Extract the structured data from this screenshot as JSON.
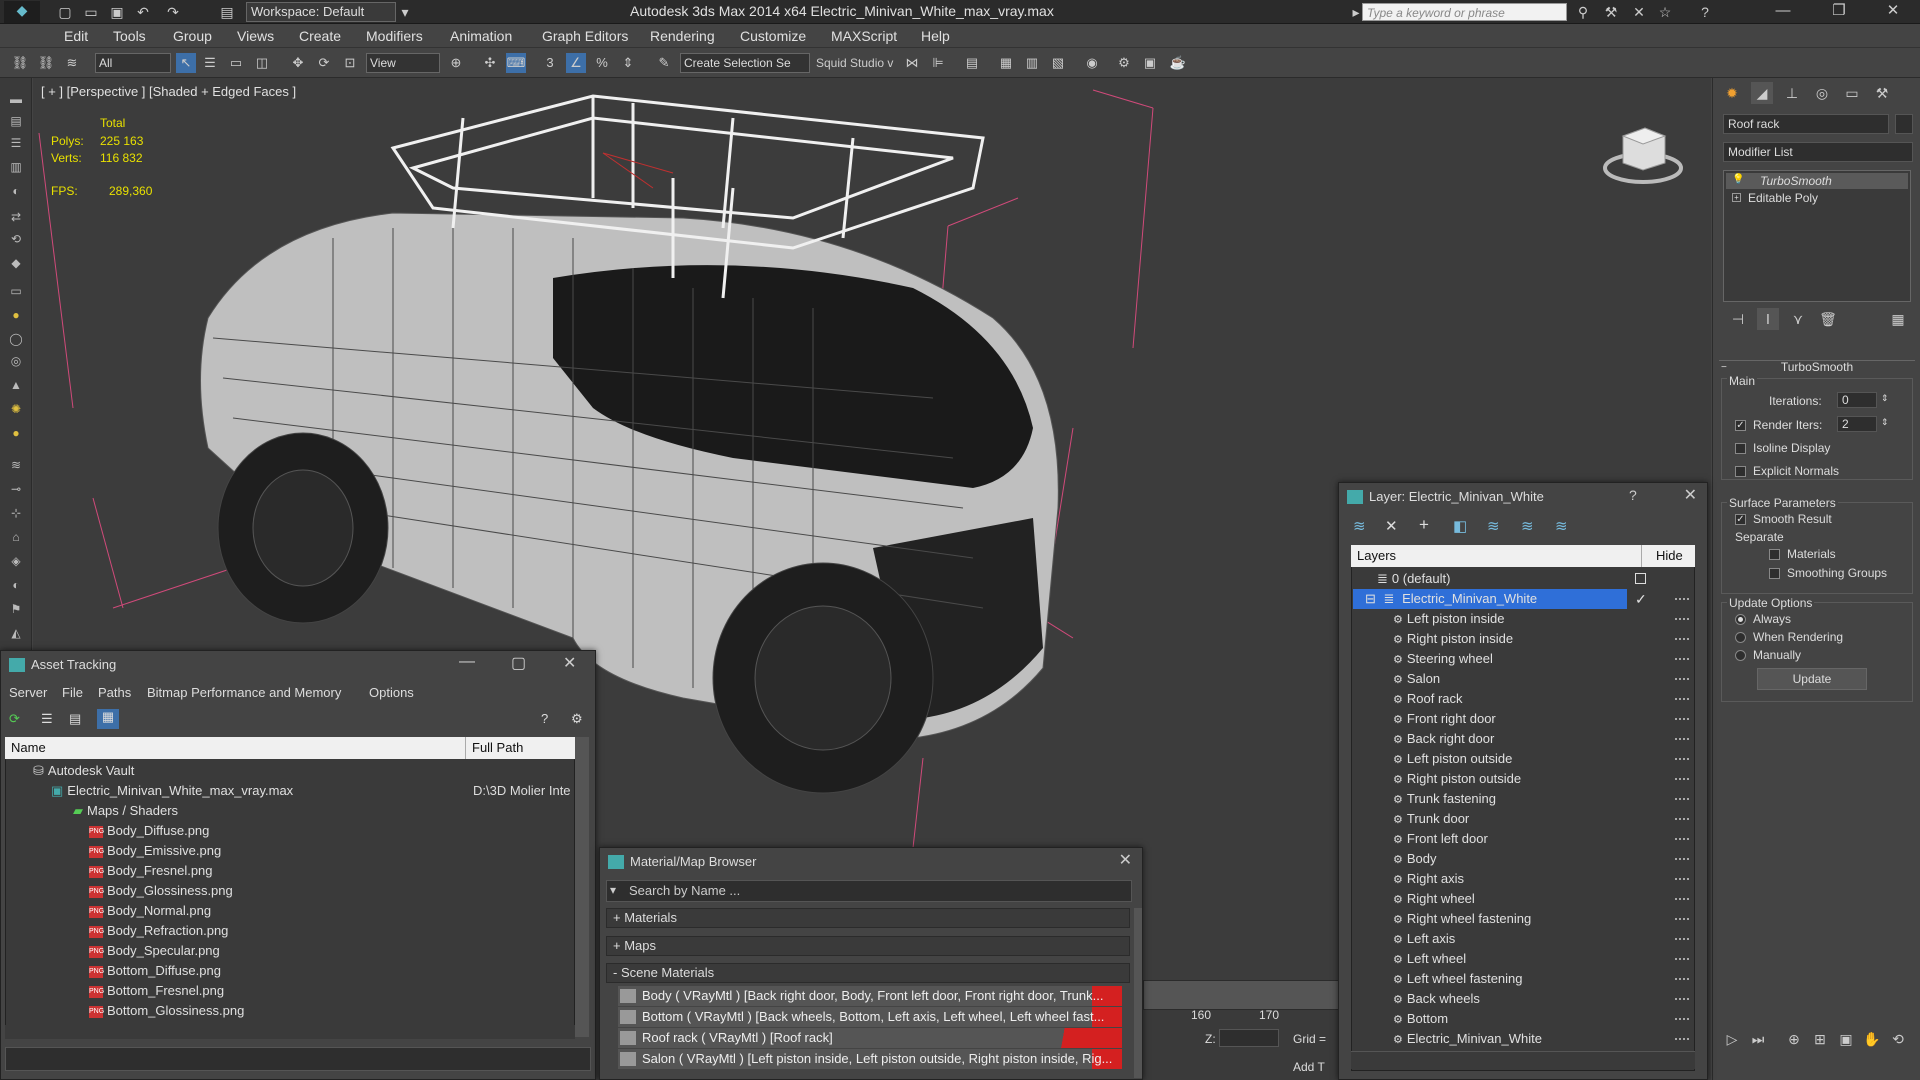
{
  "title_bar": {
    "workspace": "Workspace: Default",
    "window_title": "Autodesk 3ds Max  2014 x64      Electric_Minivan_White_max_vray.max",
    "search_placeholder": "Type a keyword or phrase"
  },
  "menu": [
    "Edit",
    "Tools",
    "Group",
    "Views",
    "Create",
    "Modifiers",
    "Animation",
    "Graph Editors",
    "Rendering",
    "Customize",
    "MAXScript",
    "Help"
  ],
  "toolbar": {
    "filter_select": "All",
    "view_select": "View",
    "selection_set": "Create Selection Se",
    "squid_label": "Squid Studio v"
  },
  "viewport": {
    "label": "[ + ] [Perspective ] [Shaded + Edged Faces ]",
    "stats": {
      "total_label": "Total",
      "polys_label": "Polys:",
      "polys_value": "225 163",
      "verts_label": "Verts:",
      "verts_value": "116 832",
      "fps_label": "FPS:",
      "fps_value": "289,360"
    }
  },
  "command_panel": {
    "object_name": "Roof rack",
    "modifier_list": "Modifier List",
    "stack": [
      "TurboSmooth",
      "Editable Poly"
    ],
    "rollout_title": "TurboSmooth",
    "main_label": "Main",
    "iterations_label": "Iterations:",
    "iterations_value": "0",
    "render_iters_label": "Render Iters:",
    "render_iters_value": "2",
    "isoline_label": "Isoline Display",
    "explicit_normals_label": "Explicit Normals",
    "surface_params_label": "Surface Parameters",
    "smooth_result_label": "Smooth Result",
    "separate_label": "Separate",
    "materials_label": "Materials",
    "smoothing_groups_label": "Smoothing Groups",
    "update_options_label": "Update Options",
    "always_label": "Always",
    "when_rendering_label": "When Rendering",
    "manually_label": "Manually",
    "update_button": "Update"
  },
  "asset_tracking": {
    "title": "Asset Tracking",
    "menu": [
      "Server",
      "File",
      "Paths",
      "Bitmap Performance and Memory",
      "Options"
    ],
    "col_name": "Name",
    "col_path": "Full Path",
    "vault": "Autodesk Vault",
    "file_name": "Electric_Minivan_White_max_vray.max",
    "file_path": "D:\\3D Molier Inte",
    "maps_folder": "Maps / Shaders",
    "maps": [
      "Body_Diffuse.png",
      "Body_Emissive.png",
      "Body_Fresnel.png",
      "Body_Glossiness.png",
      "Body_Normal.png",
      "Body_Refraction.png",
      "Body_Specular.png",
      "Bottom_Diffuse.png",
      "Bottom_Fresnel.png",
      "Bottom_Glossiness.png"
    ]
  },
  "material_browser": {
    "title": "Material/Map Browser",
    "search_placeholder": "Search by Name ...",
    "rollouts": [
      "+ Materials",
      "+ Maps",
      "- Scene Materials"
    ],
    "materials": [
      "Body  ( VRayMtl ) [Back right door, Body, Front left door, Front right door, Trunk...",
      "Bottom  ( VRayMtl ) [Back wheels, Bottom, Left axis, Left wheel, Left wheel fast...",
      "Roof rack  ( VRayMtl ) [Roof rack]",
      "Salon  ( VRayMtl ) [Left piston inside, Left piston outside, Right piston inside, Rig..."
    ]
  },
  "layer_window": {
    "title": "Layer: Electric_Minivan_White",
    "col_layers": "Layers",
    "col_hide": "Hide",
    "default_layer": "0 (default)",
    "active_layer": "Electric_Minivan_White",
    "objects": [
      "Left piston inside",
      "Right piston inside",
      "Steering wheel",
      "Salon",
      "Roof rack",
      "Front right door",
      "Back right door",
      "Left piston outside",
      "Right piston outside",
      "Trunk fastening",
      "Trunk door",
      "Front left door",
      "Body",
      "Right axis",
      "Right wheel",
      "Right wheel fastening",
      "Left axis",
      "Left wheel",
      "Left wheel fastening",
      "Back wheels",
      "Bottom",
      "Electric_Minivan_White"
    ]
  },
  "timeline": {
    "tick_160": "160",
    "tick_170": "170",
    "z_label": "Z:",
    "grid_label": "Grid =",
    "add_t_label": "Add T"
  },
  "colors": {
    "selection_blue": "#2f6fd8",
    "material_red": "#d42020",
    "stats_yellow": "#e8e000"
  }
}
